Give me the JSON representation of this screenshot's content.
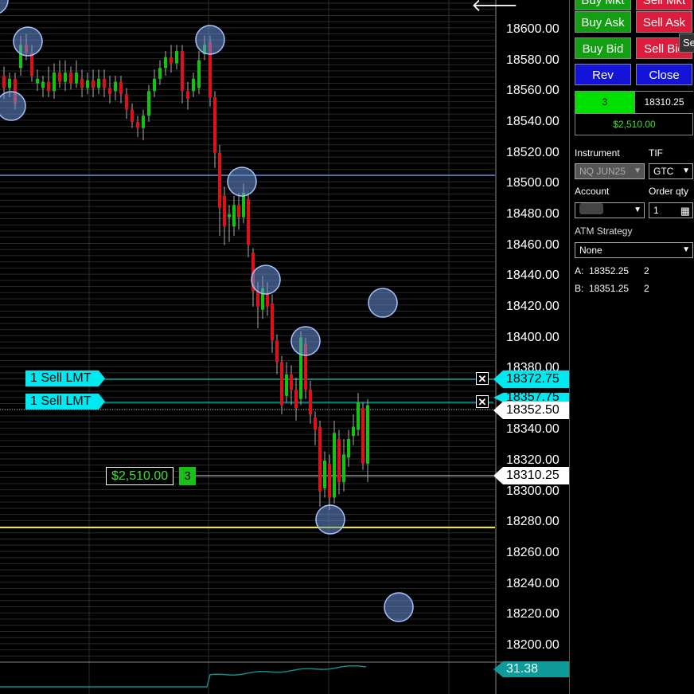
{
  "chart": {
    "price_labels": [
      "18600.00",
      "18580.00",
      "18560.00",
      "18540.00",
      "18520.00",
      "18500.00",
      "18480.00",
      "18460.00",
      "18440.00",
      "18420.00",
      "18400.00",
      "18380.00",
      "18340.00",
      "18320.00",
      "18300.00",
      "18280.00",
      "18260.00",
      "18240.00",
      "18220.00",
      "18200.00"
    ],
    "tags": {
      "sell_order_1_price": "18372.75",
      "sell_order_2_price": "18357.75",
      "last_price": "18352.50",
      "position_price": "18310.25",
      "indicator_value": "31.38"
    },
    "orders": [
      {
        "label": "1 Sell LMT",
        "cancel": "✕"
      },
      {
        "label": "1 Sell LMT",
        "cancel": "✕"
      }
    ],
    "position": {
      "pnl": "$2,510.00",
      "qty": "3"
    },
    "back_arrow": "🡐",
    "colors": {
      "up": "#12c412",
      "down": "#e0101a",
      "blue_line": "#5b8ed8",
      "yellow_line": "#f0f000",
      "cyan": "#00e8f0",
      "circle": "#6a8fd6"
    }
  },
  "panel": {
    "buttons": {
      "buy_mkt": "Buy Mkt",
      "sell_mkt": "Sell Mkt",
      "buy_ask": "Buy Ask",
      "sell_ask": "Sell Ask",
      "buy_bid": "Buy Bid",
      "sell_bid": "Sell Bid",
      "rev": "Rev",
      "close": "Close"
    },
    "tooltip": "Se",
    "position": {
      "qty": "3",
      "avg_price": "18310.25",
      "pnl": "$2,510.00"
    },
    "instrument_label": "Instrument",
    "instrument_value": "NQ JUN25",
    "tif_label": "TIF",
    "tif_value": "GTC",
    "account_label": "Account",
    "order_qty_label": "Order qty",
    "order_qty_value": "1",
    "strategy_label": "ATM Strategy",
    "strategy_value": "None",
    "ask_label": "A:",
    "ask_price": "18352.25",
    "ask_size": "2",
    "bid_label": "B:",
    "bid_price": "18351.25",
    "bid_size": "2"
  }
}
